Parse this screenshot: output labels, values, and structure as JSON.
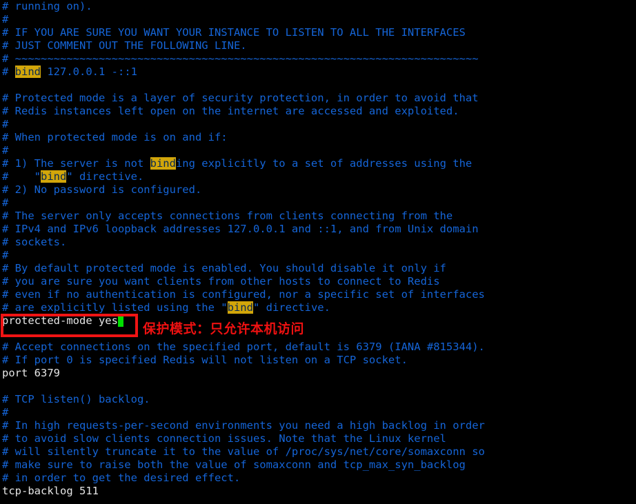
{
  "terminal": {
    "background_color": "#000000",
    "comment_color": "#1565d8",
    "directive_color": "#e6e6e6",
    "highlight_bg_color": "#d2a60a",
    "highlight_fg_color": "#0a2a52",
    "cursor_color": "#00e000",
    "annotation_color": "#ee1111",
    "box_color": "#f01414"
  },
  "lines": [
    {
      "id": "l01",
      "kind": "comment",
      "text": "# running on)."
    },
    {
      "id": "l02",
      "kind": "comment",
      "text": "#"
    },
    {
      "id": "l03",
      "kind": "comment",
      "text": "# IF YOU ARE SURE YOU WANT YOUR INSTANCE TO LISTEN TO ALL THE INTERFACES"
    },
    {
      "id": "l04",
      "kind": "comment",
      "text": "# JUST COMMENT OUT THE FOLLOWING LINE."
    },
    {
      "id": "l05",
      "kind": "comment",
      "text": "# ~~~~~~~~~~~~~~~~~~~~~~~~~~~~~~~~~~~~~~~~~~~~~~~~~~~~~~~~~~~~~~~~~~~~~~~~"
    },
    {
      "id": "l06",
      "kind": "comment-highlight",
      "pre": "# ",
      "hl": "bind",
      "post": " 127.0.0.1 -::1"
    },
    {
      "id": "l07",
      "kind": "blank",
      "text": ""
    },
    {
      "id": "l08",
      "kind": "comment",
      "text": "# Protected mode is a layer of security protection, in order to avoid that"
    },
    {
      "id": "l09",
      "kind": "comment",
      "text": "# Redis instances left open on the internet are accessed and exploited."
    },
    {
      "id": "l10",
      "kind": "comment",
      "text": "#"
    },
    {
      "id": "l11",
      "kind": "comment",
      "text": "# When protected mode is on and if:"
    },
    {
      "id": "l12",
      "kind": "comment",
      "text": "#"
    },
    {
      "id": "l13",
      "kind": "comment-highlight",
      "pre": "# 1) The server is not ",
      "hl": "bind",
      "post": "ing explicitly to a set of addresses using the"
    },
    {
      "id": "l14",
      "kind": "comment-highlight",
      "pre": "#    \"",
      "hl": "bind",
      "post": "\" directive."
    },
    {
      "id": "l15",
      "kind": "comment",
      "text": "# 2) No password is configured."
    },
    {
      "id": "l16",
      "kind": "comment",
      "text": "#"
    },
    {
      "id": "l17",
      "kind": "comment",
      "text": "# The server only accepts connections from clients connecting from the"
    },
    {
      "id": "l18",
      "kind": "comment",
      "text": "# IPv4 and IPv6 loopback addresses 127.0.0.1 and ::1, and from Unix domain"
    },
    {
      "id": "l19",
      "kind": "comment",
      "text": "# sockets."
    },
    {
      "id": "l20",
      "kind": "comment",
      "text": "#"
    },
    {
      "id": "l21",
      "kind": "comment",
      "text": "# By default protected mode is enabled. You should disable it only if"
    },
    {
      "id": "l22",
      "kind": "comment",
      "text": "# you are sure you want clients from other hosts to connect to Redis"
    },
    {
      "id": "l23",
      "kind": "comment",
      "text": "# even if no authentication is configured, nor a specific set of interfaces"
    },
    {
      "id": "l24",
      "kind": "comment-highlight",
      "pre": "# are explicitly listed using the \"",
      "hl": "bind",
      "post": "\" directive."
    },
    {
      "id": "l25",
      "kind": "directive-cursor",
      "text": "protected-mode yes"
    },
    {
      "id": "l26",
      "kind": "blank",
      "text": ""
    },
    {
      "id": "l27",
      "kind": "comment",
      "text": "# Accept connections on the specified port, default is 6379 (IANA #815344)."
    },
    {
      "id": "l28",
      "kind": "comment",
      "text": "# If port 0 is specified Redis will not listen on a TCP socket."
    },
    {
      "id": "l29",
      "kind": "directive",
      "text": "port 6379"
    },
    {
      "id": "l30",
      "kind": "blank",
      "text": ""
    },
    {
      "id": "l31",
      "kind": "comment",
      "text": "# TCP listen() backlog."
    },
    {
      "id": "l32",
      "kind": "comment",
      "text": "#"
    },
    {
      "id": "l33",
      "kind": "comment",
      "text": "# In high requests-per-second environments you need a high backlog in order"
    },
    {
      "id": "l34",
      "kind": "comment",
      "text": "# to avoid slow clients connection issues. Note that the Linux kernel"
    },
    {
      "id": "l35",
      "kind": "comment",
      "text": "# will silently truncate it to the value of /proc/sys/net/core/somaxconn so"
    },
    {
      "id": "l36",
      "kind": "comment",
      "text": "# make sure to raise both the value of somaxconn and tcp_max_syn_backlog"
    },
    {
      "id": "l37",
      "kind": "comment",
      "text": "# in order to get the desired effect."
    },
    {
      "id": "l38",
      "kind": "directive",
      "text": "tcp-backlog 511"
    }
  ],
  "annotation": {
    "text": "保护模式：只允许本机访问"
  },
  "search_term": "bind",
  "cursor": {
    "glyph": " "
  }
}
